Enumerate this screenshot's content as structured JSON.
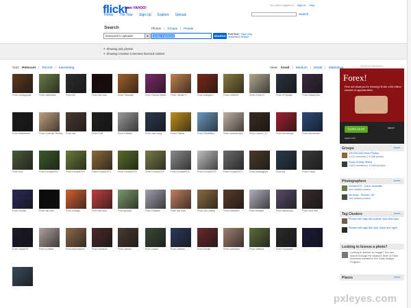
{
  "header": {
    "logo_text": "flickr",
    "logo_sub": "from YAHOO!",
    "nav": [
      "Home",
      "The Tour",
      "Sign Up",
      "Explore",
      "Upload"
    ],
    "top_links": [
      "You aren't signed in",
      "Sign In",
      "Help"
    ],
    "top_search_label": "Search"
  },
  "search": {
    "title": "Search",
    "tabs": [
      "Photos",
      "Groups",
      "People"
    ],
    "scope_value": "Everyone's Uploads",
    "query": "scary madness",
    "button": "SEARCH",
    "full_text": "Full Text",
    "tags_only": "Tags Only",
    "advanced": "Advanced Search"
  },
  "filters": {
    "options": [
      "Showing only photos",
      "Showing Creative Commons-licensed content"
    ]
  },
  "sort": {
    "label": "Sort:",
    "options": [
      "Relevant",
      "Recent",
      "Interesting"
    ]
  },
  "view": {
    "label": "View:",
    "options": [
      "Small",
      "Medium",
      "Detail",
      "Slideshow"
    ]
  },
  "photos": [
    {
      "caption": "From nickkgoodii",
      "color": "#5a3a20"
    },
    {
      "caption": "From cabinlake",
      "color": "#6b7a4a"
    },
    {
      "caption": "From bill",
      "color": "#2d2d2d"
    },
    {
      "caption": "From del soul",
      "color": "#1a0a08"
    },
    {
      "caption": "From Sarcade",
      "color": "#a0602a"
    },
    {
      "caption": "From Rachel Black",
      "color": "#7a2a6a"
    },
    {
      "caption": "From Tarzan S.",
      "color": "#c08050"
    },
    {
      "caption": "From mangero",
      "color": "#7a2a1a"
    },
    {
      "caption": "From ruthie35",
      "color": "#8a7a40"
    },
    {
      "caption": "From Kevin H.",
      "color": "#b0a890"
    },
    {
      "caption": "From A**tocaki",
      "color": "#2a3240"
    },
    {
      "caption": "From Black&Tan",
      "color": "#3a2a40"
    },
    {
      "caption": "From thelastmel",
      "color": "#1c1c1c"
    },
    {
      "caption": "From Comrad Theory",
      "color": "#c0a080"
    },
    {
      "caption": "From lan",
      "color": "#4a3a30"
    },
    {
      "caption": "From Phill",
      "color": "#202020"
    },
    {
      "caption": "From Kitchen",
      "color": "#9a9a9a"
    },
    {
      "caption": "From Jan-Lang",
      "color": "#2a3a50"
    },
    {
      "caption": "From Patrick",
      "color": "#c09020"
    },
    {
      "caption": "From Dimitrillou",
      "color": "#6a9ac0"
    },
    {
      "caption": "From vomera swe",
      "color": "#c0b0a0"
    },
    {
      "caption": "From rockort_12",
      "color": "#3a2a20"
    },
    {
      "caption": "From theodrogn",
      "color": "#a02030"
    },
    {
      "caption": "From ubuuhoom",
      "color": "#2a4a7a"
    },
    {
      "caption": "From tool",
      "color": "#4a5a3a"
    },
    {
      "caption": "From Kenad1970",
      "color": "#3a5a2a"
    },
    {
      "caption": "From Kenad1970",
      "color": "#6a7a3a"
    },
    {
      "caption": "From Kenad1970",
      "color": "#8a6a3a"
    },
    {
      "caption": "From Kenad1970",
      "color": "#5a6a2a"
    },
    {
      "caption": "From Kenad1970",
      "color": "#7a7a4a"
    },
    {
      "caption": "From Kenad1970",
      "color": "#8a8a8a"
    },
    {
      "caption": "From Kenad1970",
      "color": "#c0c0c0"
    },
    {
      "caption": "From Kenad1970",
      "color": "#6a6a6a"
    },
    {
      "caption": "From antelagues",
      "color": "#4a3a2a"
    },
    {
      "caption": "From fuj",
      "color": "#2a3a4a"
    },
    {
      "caption": "From Fuzzy",
      "color": "#3a3a3a"
    },
    {
      "caption": "From Kenad",
      "color": "#2a2a5a"
    },
    {
      "caption": "From del soul",
      "color": "#0a0a0a"
    },
    {
      "caption": "From orange",
      "color": "#d06030"
    },
    {
      "caption": "From del soul",
      "color": "#c04040"
    },
    {
      "caption": "From jessica",
      "color": "#7a9a6a"
    },
    {
      "caption": "From Elisabet",
      "color": "#a0a0b0"
    },
    {
      "caption": "From del soul",
      "color": "#c08060"
    },
    {
      "caption": "From Jim carrey",
      "color": "#8a6a40"
    },
    {
      "caption": "From metaldre",
      "color": "#5a3a2a"
    },
    {
      "caption": "From imadeb",
      "color": "#b0b0c0"
    },
    {
      "caption": "From aavblums",
      "color": "#5a4a6a"
    },
    {
      "caption": "From Just Jeb",
      "color": "#3a2a2a"
    },
    {
      "caption": "From Jason70",
      "color": "#1a1a2a"
    },
    {
      "caption": "From Amidea",
      "color": "#b0a0a0"
    },
    {
      "caption": "From fencodoms",
      "color": "#8a6a4a"
    },
    {
      "caption": "From kirkdesn",
      "color": "#4a2a2a"
    },
    {
      "caption": "From James",
      "color": "#4a3a30"
    },
    {
      "caption": "From Joach",
      "color": "#3a4a3a"
    },
    {
      "caption": "From Jeanne",
      "color": "#2a3a5a"
    },
    {
      "caption": "From Esmin",
      "color": "#6a2a2a"
    },
    {
      "caption": "From madnans",
      "color": "#a08070"
    },
    {
      "caption": "From willenst",
      "color": "#5a6a3a"
    },
    {
      "caption": "From Gymkoke",
      "color": "#2a2a2a"
    },
    {
      "caption": "",
      "color": "#1a1a3a"
    },
    {
      "caption": "",
      "color": "#3a4a5a"
    }
  ],
  "sidebar": {
    "ad_label": "ADVERTISEMENT",
    "ad_title": "Forex!",
    "ad_sub": "Find out what you're missing! Enter a $4 trillion market of opportunities",
    "ad_button": "Come on in!",
    "ad_brand": "alpari",
    "ad_url": "alpari.com",
    "groups": {
      "title": "Groups",
      "more": "more...",
      "items": [
        {
          "title": "100,000,000 Flickr Photos",
          "sub": "1,211 members | 9,288 photos",
          "color": "#8a6a3a"
        },
        {
          "title": "Scary Creepy Weird",
          "sub": "1,820 members | 13,600 photos",
          "color": "#3a3a3a"
        }
      ]
    },
    "photographers": {
      "title": "Photographers",
      "more": "more...",
      "items": [
        {
          "title": "Kenad1970 - Cairo, Australia",
          "sub": "See related photos",
          "color": "#6a7a4a"
        },
        {
          "title": "lan boyd - Shanlin, UK",
          "sub": "See related photos",
          "color": "#4a4a4a"
        }
      ]
    },
    "tag_clusters": {
      "title": "Tag Clusters",
      "more": "more...",
      "items": [
        {
          "title": "Photos with tags like portrait, face and eyes",
          "color": "#7a5a4a"
        },
        {
          "title": "Photos with tags like dark, black and night",
          "color": "#2a2a2a"
        }
      ]
    },
    "license": {
      "title": "Looking to license a photo?",
      "text": "Looking to license an image? You can search through the treasure trove of Flickr members enrolled in the Getty Images Program."
    },
    "places": {
      "title": "Places",
      "more": "more..."
    }
  },
  "watermark": "pxleyes.com"
}
